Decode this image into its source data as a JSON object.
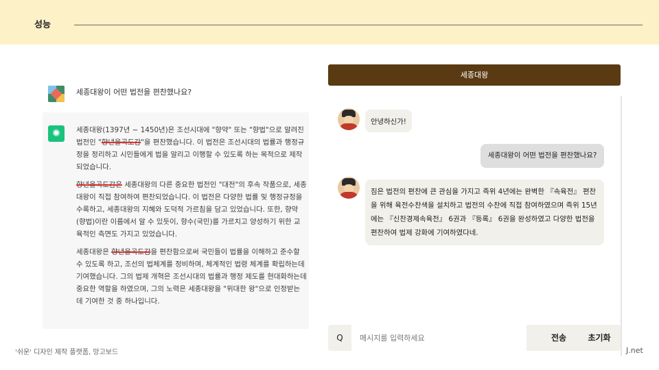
{
  "page": {
    "title": "성능"
  },
  "gpt": {
    "question": "세종대왕이 어떤 법전을 편찬했나요?",
    "paragraphs": [
      [
        "세종대왕(1397년 ~ 1450년)은 조선시대에 \"향약\" 또는 \"향법\"으로 알려진 법전인 \"",
        {
          "strike": "향년을곡도감"
        },
        "\"을 편찬했습니다. 이 법전은 조선시대의 법률과 행정규정을 정리하고 시민들에게 법을 알리고 이행할 수 있도록 하는 목적으로 제작되었습니다."
      ],
      [
        {
          "strike": "향년을곡도감은"
        },
        " 세종대왕의 다른 중요한 법전인 \"대전\"의 후속 작품으로, 세종대왕이 직접 참여하여 편찬되었습니다. 이 법전은 다양한 법률 및 행정규정을 수록하고, 세종대왕의 지혜와 도덕적 가르침을 담고 있었습니다. 또한, 향약(향법)이란 이름에서 알 수 있듯이, 향수(국민)를 가르치고 양성하기 위한 교육적인 측면도 가지고 있었습니다."
      ],
      [
        "세종대왕은 ",
        {
          "strike": "향년을곡도감"
        },
        "을 편찬함으로써 국민들이 법률을 이해하고 준수할 수 있도록 하고, 조선의 법체계를 정비하며, 체계적인 법령 체계를 확립하는데 기여했습니다. 그의 법제 개혁은 조선시대의 법률과 행정 제도를 현대화하는데 중요한 역할을 하였으며, 그의 노력은 세종대왕을 \"위대한 왕\"으로 인정받는 데 기여한 것 중 하나입니다."
      ]
    ]
  },
  "chat": {
    "header": "세종대왕",
    "greeting": "안녕하신가!",
    "user_message": "세종대왕이 어떤 법전을 편찬했나요?",
    "bot_reply": "짐은 법전의 편찬에 큰 관심을 가지고 즉위 4년에는 완벽한 『속육전』 편찬을 위해 육전수찬색을 설치하고 법전의 수찬에 직접 참여하였으며 즉위 15년에는 『신찬경제속육전』 6권과 『등록』 6권을 완성하였고 다양한 법전을 편찬하여 법제 강화에 기여하였다네.",
    "input_prefix": "Q",
    "input_placeholder": "메시지를 입력하세요",
    "send_label": "전송",
    "reset_label": "초기화"
  },
  "footer": {
    "left": "'쉬운' 디자인 제작 플랫폼, 망고보드",
    "right": "J.net"
  },
  "colors": {
    "topbar": "#fdf1c7",
    "chat_header": "#5a3a12",
    "bot_bubble": "#f1f0ea",
    "user_bubble": "#dedede",
    "gpt_logo": "#19c37d",
    "strike": "#d9342b"
  }
}
